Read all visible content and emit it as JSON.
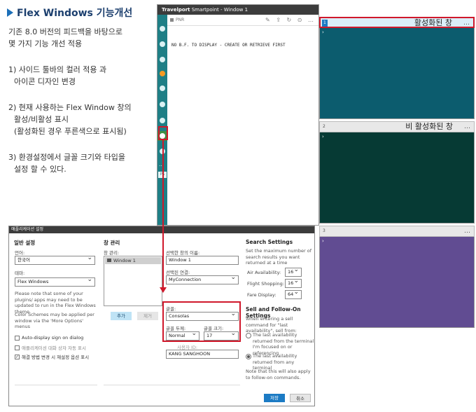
{
  "heading": "Flex Windows 기능개선",
  "notes": {
    "intro_1": "기존 8.0 버전의 피드백을 바탕으로",
    "intro_2": "몇 가지 기능 개선 적용",
    "item1_1": "1) 사이드 툴바의 컬러 적용 과",
    "item1_2": "아이콘 디자인 변경",
    "item2_1": "2) 현재 사용하는 Flex Window 창의",
    "item2_2": "활성/비활성 표시",
    "item2_3": "(활성화된 경우 푸른색으로 표시됨)",
    "item3_1": "3) 환경설정에서 글꼴 크기와 타입을",
    "item3_2": "설정 할 수 있다."
  },
  "app": {
    "title_brand": "Travelport",
    "title_rest": " Smartpoint - Window 1",
    "pnr_label": "PNR",
    "terminal_message": "NO B.F. TO DISPLAY - CREATE OR RETRIEVE FIRST",
    "sidebar_label": "PS"
  },
  "panels": [
    {
      "number": "1",
      "title": "활성화된 창",
      "color": "#0c5c6e",
      "active": true
    },
    {
      "number": "2",
      "title": "비 활성화된 창",
      "color": "#063a34",
      "active": false
    },
    {
      "number": "3",
      "title": "",
      "color": "#614c92",
      "active": false
    }
  ],
  "dialog": {
    "title": "애플리케이션 설정",
    "general": {
      "heading": "일반 설정",
      "language_label": "언어:",
      "language_value": "한국어",
      "theme_label": "테마:",
      "theme_value": "Flex Windows",
      "note1": "Please note that some of your plugins/ apps may need to be updated to run in the Flex Windows theme.",
      "note2": "Color Schemes may be applied per window via the 'More Options' menus",
      "auto_display": "Auto-display sign on dialog",
      "app_dialog": "애플리케이션 대화 상자 자동 표시",
      "resolve": "해결 방법 변경 시 재설정 옵션 표시"
    },
    "window_mgmt": {
      "heading": "창 관리",
      "list_label": "창 관리:",
      "list_item": "Window 1",
      "add_button": "추가",
      "remove_button": "제거",
      "selected_name_label": "선택한 창의 이름:",
      "selected_name_value": "Window 1",
      "connection_label": "선택된 연결:",
      "connection_value": "MyConnection",
      "font_label": "글꼴:",
      "font_value": "Consolas",
      "weight_label": "글꼴 두께:",
      "weight_value": "Normal",
      "size_label": "글꼴 크기:",
      "size_value": "17",
      "user_label": "사용자 ID:",
      "user_value": "KANG SANGHOON"
    },
    "search": {
      "heading": "Search Settings",
      "desc": "Set the maximum number of search results you want returned at a time",
      "air_label": "Air Availability:",
      "air_value": "16",
      "flight_label": "Flight Shopping:",
      "flight_value": "16",
      "fare_label": "Fare Display:",
      "fare_value": "64"
    },
    "sell": {
      "heading": "Sell and Follow-On Settings",
      "desc": "When entering a sell command for \"last availability\", sell from:",
      "option1": "The last availability returned from the terminal I'm focused on or referencing",
      "option2": "The last availability returned from any terminal",
      "note": "Note that this will also apply to follow-on commands."
    },
    "save_button": "저장",
    "cancel_button": "취소"
  },
  "colors": {
    "accent_red": "#d0182b",
    "active_blue": "#1c7bc4",
    "sidebar_teal": "#1e7f86"
  }
}
